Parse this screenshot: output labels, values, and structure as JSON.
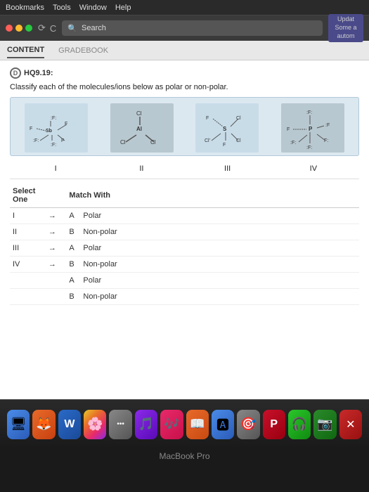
{
  "menu": {
    "items": [
      "Bookmarks",
      "Tools",
      "Window",
      "Help"
    ]
  },
  "browser": {
    "search_placeholder": "Search",
    "update_text": "Updat Some a autom"
  },
  "nav": {
    "tabs": [
      {
        "label": "CONTENT",
        "active": true
      },
      {
        "label": "GRADEBOOK",
        "active": false
      }
    ]
  },
  "question": {
    "id": "HQ9.19:",
    "text": "Classify each of the molecules/ions below as polar or non-polar.",
    "molecules": [
      {
        "label": "I"
      },
      {
        "label": "II"
      },
      {
        "label": "III"
      },
      {
        "label": "IV"
      }
    ]
  },
  "matching": {
    "header_left": "Select One",
    "header_right": "Match With",
    "rows": [
      {
        "left": "I",
        "right_letter": "A",
        "right_value": "Polar"
      },
      {
        "left": "II",
        "right_letter": "B",
        "right_value": "Non-polar"
      },
      {
        "left": "III",
        "right_letter": "A",
        "right_value": "Polar"
      },
      {
        "left": "IV",
        "right_letter": "B",
        "right_value": "Non-polar"
      }
    ],
    "extra_options": [
      {
        "letter": "A",
        "value": "Polar"
      },
      {
        "letter": "B",
        "value": "Non-polar"
      }
    ]
  },
  "dock": {
    "icons": [
      {
        "name": "finder",
        "emoji": "🔵"
      },
      {
        "name": "firefox",
        "emoji": "🦊"
      },
      {
        "name": "word",
        "emoji": "W"
      },
      {
        "name": "photos",
        "emoji": "🌸"
      },
      {
        "name": "more",
        "emoji": "•••"
      },
      {
        "name": "music",
        "emoji": "♪"
      },
      {
        "name": "books",
        "emoji": "📚"
      },
      {
        "name": "a-app",
        "emoji": "A"
      },
      {
        "name": "target",
        "emoji": "🎯"
      },
      {
        "name": "powerpoint",
        "emoji": "P"
      },
      {
        "name": "spotify",
        "emoji": "♫"
      },
      {
        "name": "facetime",
        "emoji": "📷"
      },
      {
        "name": "close",
        "emoji": "✕"
      }
    ],
    "macbook_label": "MacBook Pro"
  }
}
